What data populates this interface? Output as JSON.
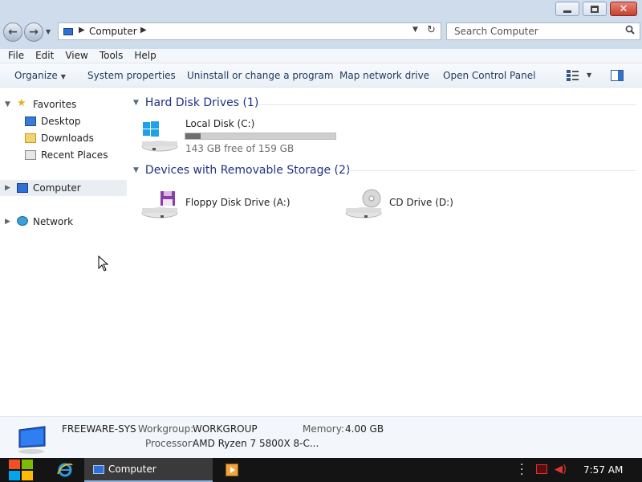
{
  "window": {
    "controls": [
      "minimize",
      "maximize",
      "close"
    ]
  },
  "nav": {
    "address_icon": "computer-icon",
    "address_text": "Computer",
    "search_placeholder": "Search Computer"
  },
  "menu": [
    "File",
    "Edit",
    "View",
    "Tools",
    "Help"
  ],
  "commands": {
    "organize": "Organize",
    "system_properties": "System properties",
    "uninstall": "Uninstall or change a program",
    "map_drive": "Map network drive",
    "control_panel": "Open Control Panel"
  },
  "sidebar": {
    "favorites": "Favorites",
    "desktop": "Desktop",
    "downloads": "Downloads",
    "recent": "Recent Places",
    "computer": "Computer",
    "network": "Network"
  },
  "content": {
    "hdd_group": "Hard Disk Drives (1)",
    "local_disk": {
      "name": "Local Disk (C:)",
      "free_text": "143 GB free of 159 GB",
      "used_fraction": 0.1
    },
    "removable_group": "Devices with Removable Storage (2)",
    "floppy": "Floppy Disk Drive (A:)",
    "cd": "CD Drive (D:)"
  },
  "details": {
    "computer_name": "FREEWARE-SYS",
    "workgroup_label": "Workgroup:",
    "workgroup_value": "WORKGROUP",
    "memory_label": "Memory:",
    "memory_value": "4.00 GB",
    "processor_label": "Processor:",
    "processor_value": "AMD Ryzen 7 5800X 8-C..."
  },
  "taskbar": {
    "active_window": "Computer",
    "clock": "7:57 AM"
  },
  "colors": {
    "titlebar": "#cfdcec",
    "group_heading": "#1e3287",
    "taskbar": "#141414",
    "selection": "#eaeef3"
  }
}
